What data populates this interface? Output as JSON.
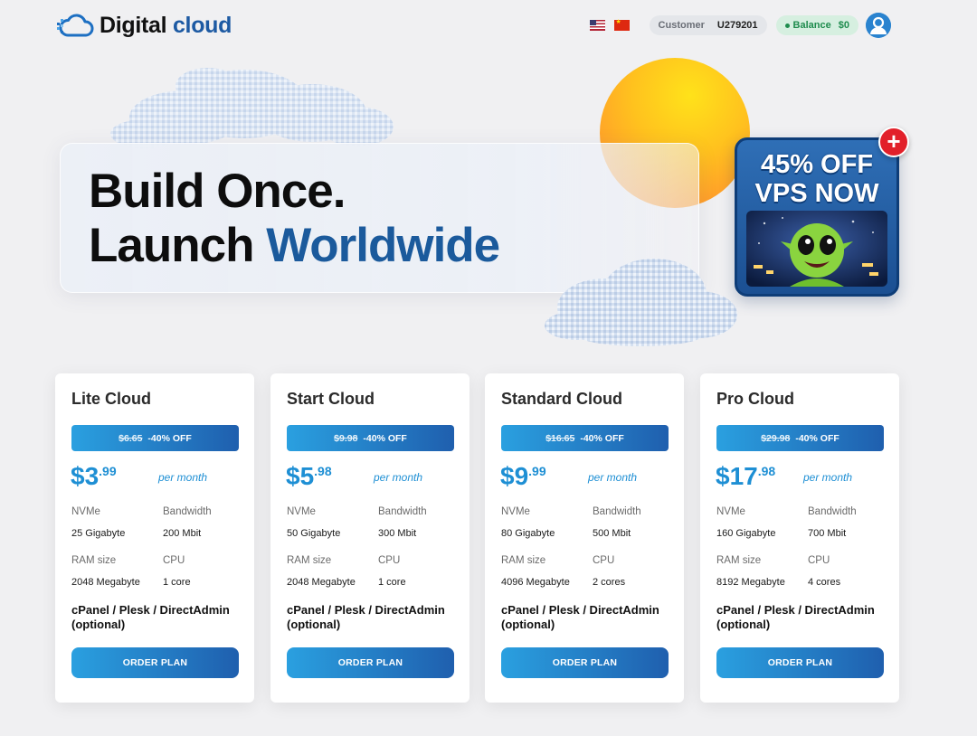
{
  "header": {
    "logo_text_1": "Digital",
    "logo_text_2": "cloud",
    "customer_label": "Customer",
    "customer_id": "U279201",
    "balance_label": "Balance",
    "balance_value": "$0"
  },
  "hero": {
    "title_line1": "Build Once.",
    "title_line2a": "Launch",
    "title_line2b": "Worldwide"
  },
  "promo": {
    "line1": "45% OFF",
    "line2": "VPS NOW",
    "plus": "+"
  },
  "plans": [
    {
      "name": "Lite Cloud",
      "old_price": "$6.65",
      "discount": "-40% OFF",
      "price_main": "$3",
      "price_cents": ".99",
      "period": "per month",
      "specs": [
        {
          "label": "NVMe",
          "value": "25 Gigabyte"
        },
        {
          "label": "Bandwidth",
          "value": "200 Mbit"
        },
        {
          "label": "RAM size",
          "value": "2048 Megabyte"
        },
        {
          "label": "CPU",
          "value": "1 core"
        }
      ],
      "panel": "cPanel / Plesk / DirectAdmin (optional)",
      "button": "ORDER PLAN"
    },
    {
      "name": "Start Cloud",
      "old_price": "$9.98",
      "discount": "-40% OFF",
      "price_main": "$5",
      "price_cents": ".98",
      "period": "per month",
      "specs": [
        {
          "label": "NVMe",
          "value": "50 Gigabyte"
        },
        {
          "label": "Bandwidth",
          "value": "300 Mbit"
        },
        {
          "label": "RAM size",
          "value": "2048 Megabyte"
        },
        {
          "label": "CPU",
          "value": "1 core"
        }
      ],
      "panel": "cPanel / Plesk / DirectAdmin (optional)",
      "button": "ORDER PLAN"
    },
    {
      "name": "Standard Cloud",
      "old_price": "$16.65",
      "discount": "-40% OFF",
      "price_main": "$9",
      "price_cents": ".99",
      "period": "per month",
      "specs": [
        {
          "label": "NVMe",
          "value": "80 Gigabyte"
        },
        {
          "label": "Bandwidth",
          "value": "500 Mbit"
        },
        {
          "label": "RAM size",
          "value": "4096 Megabyte"
        },
        {
          "label": "CPU",
          "value": "2 cores"
        }
      ],
      "panel": "cPanel / Plesk / DirectAdmin (optional)",
      "button": "ORDER PLAN"
    },
    {
      "name": "Pro Cloud",
      "old_price": "$29.98",
      "discount": "-40% OFF",
      "price_main": "$17",
      "price_cents": ".98",
      "period": "per month",
      "specs": [
        {
          "label": "NVMe",
          "value": "160 Gigabyte"
        },
        {
          "label": "Bandwidth",
          "value": "700 Mbit"
        },
        {
          "label": "RAM size",
          "value": "8192 Megabyte"
        },
        {
          "label": "CPU",
          "value": "4 cores"
        }
      ],
      "panel": "cPanel / Plesk / DirectAdmin (optional)",
      "button": "ORDER PLAN"
    }
  ],
  "icons": {
    "logo": "cloud-icon",
    "flag_1": "us-flag-icon",
    "flag_2": "china-flag-icon",
    "avatar": "user-avatar-icon"
  },
  "colors": {
    "brand_blue": "#1d5aa3",
    "price_blue": "#1e8fd4",
    "button_gradient_start": "#2aa0e0",
    "button_gradient_end": "#1f5fae",
    "balance_green": "#1f8c4e",
    "promo_red": "#e2202a"
  }
}
